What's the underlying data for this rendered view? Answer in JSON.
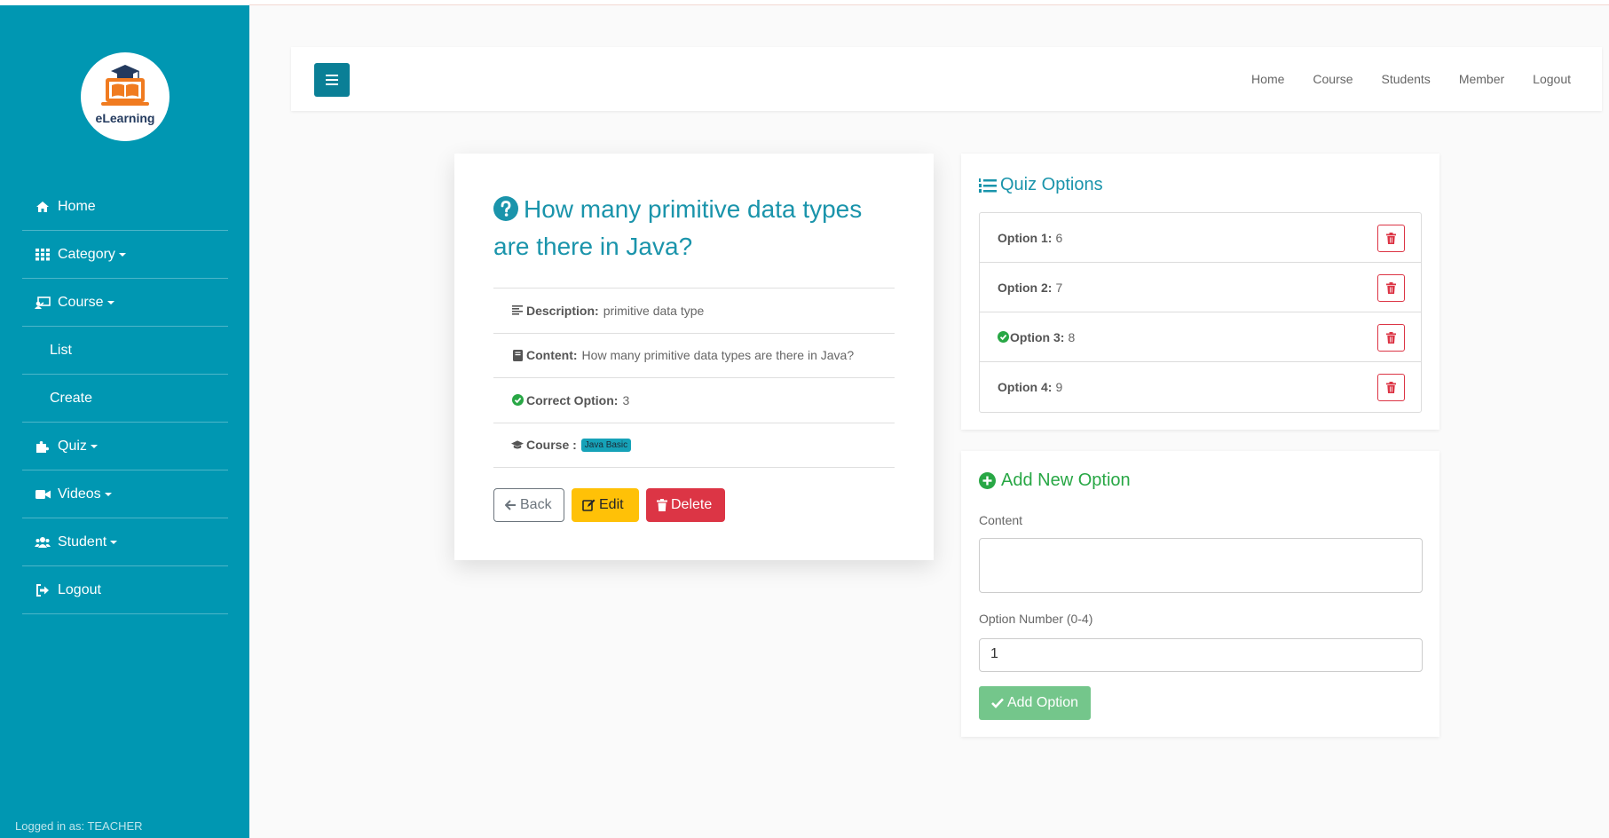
{
  "sidebar": {
    "logo_text": "eLearning",
    "items": [
      {
        "label": "Home",
        "icon": "home-icon",
        "dropdown": false
      },
      {
        "label": "Category",
        "icon": "grid-icon",
        "dropdown": true
      },
      {
        "label": "Course",
        "icon": "chalkboard-teacher-icon",
        "dropdown": true
      },
      {
        "label": "List",
        "icon": "",
        "dropdown": false
      },
      {
        "label": "Create",
        "icon": "",
        "dropdown": false
      },
      {
        "label": "Quiz",
        "icon": "puzzle-icon",
        "dropdown": true
      },
      {
        "label": "Videos",
        "icon": "video-camera-icon",
        "dropdown": true
      },
      {
        "label": "Student",
        "icon": "users-icon",
        "dropdown": true
      },
      {
        "label": "Logout",
        "icon": "sign-out-icon",
        "dropdown": false
      }
    ],
    "logged_in": "Logged in as: TEACHER"
  },
  "navbar": {
    "links": [
      "Home",
      "Course",
      "Students",
      "Member",
      "Logout"
    ]
  },
  "question": {
    "title": "How many primitive data types are there in Java?",
    "description_label": "Description:",
    "description": "primitive data type",
    "content_label": "Content:",
    "content": "How many primitive data types are there in Java?",
    "correct_label": "Correct Option:",
    "correct": "3",
    "course_label": "Course :",
    "course": "Java Basic",
    "buttons": {
      "back": "Back",
      "edit": "Edit",
      "delete": "Delete"
    }
  },
  "options": {
    "title": "Quiz Options",
    "items": [
      {
        "label": "Option 1:",
        "value": "6",
        "correct": false
      },
      {
        "label": "Option 2:",
        "value": "7",
        "correct": false
      },
      {
        "label": "Option 3:",
        "value": "8",
        "correct": true
      },
      {
        "label": "Option 4:",
        "value": "9",
        "correct": false
      }
    ]
  },
  "add_option": {
    "title": "Add New Option",
    "content_label": "Content",
    "number_label": "Option Number (0-4)",
    "number_value": "1",
    "submit": "Add Option"
  },
  "colors": {
    "sidebar": "#0097b2",
    "accent": "#1a94ab",
    "success": "#28a745",
    "danger": "#dc3545",
    "warning": "#ffc107"
  }
}
